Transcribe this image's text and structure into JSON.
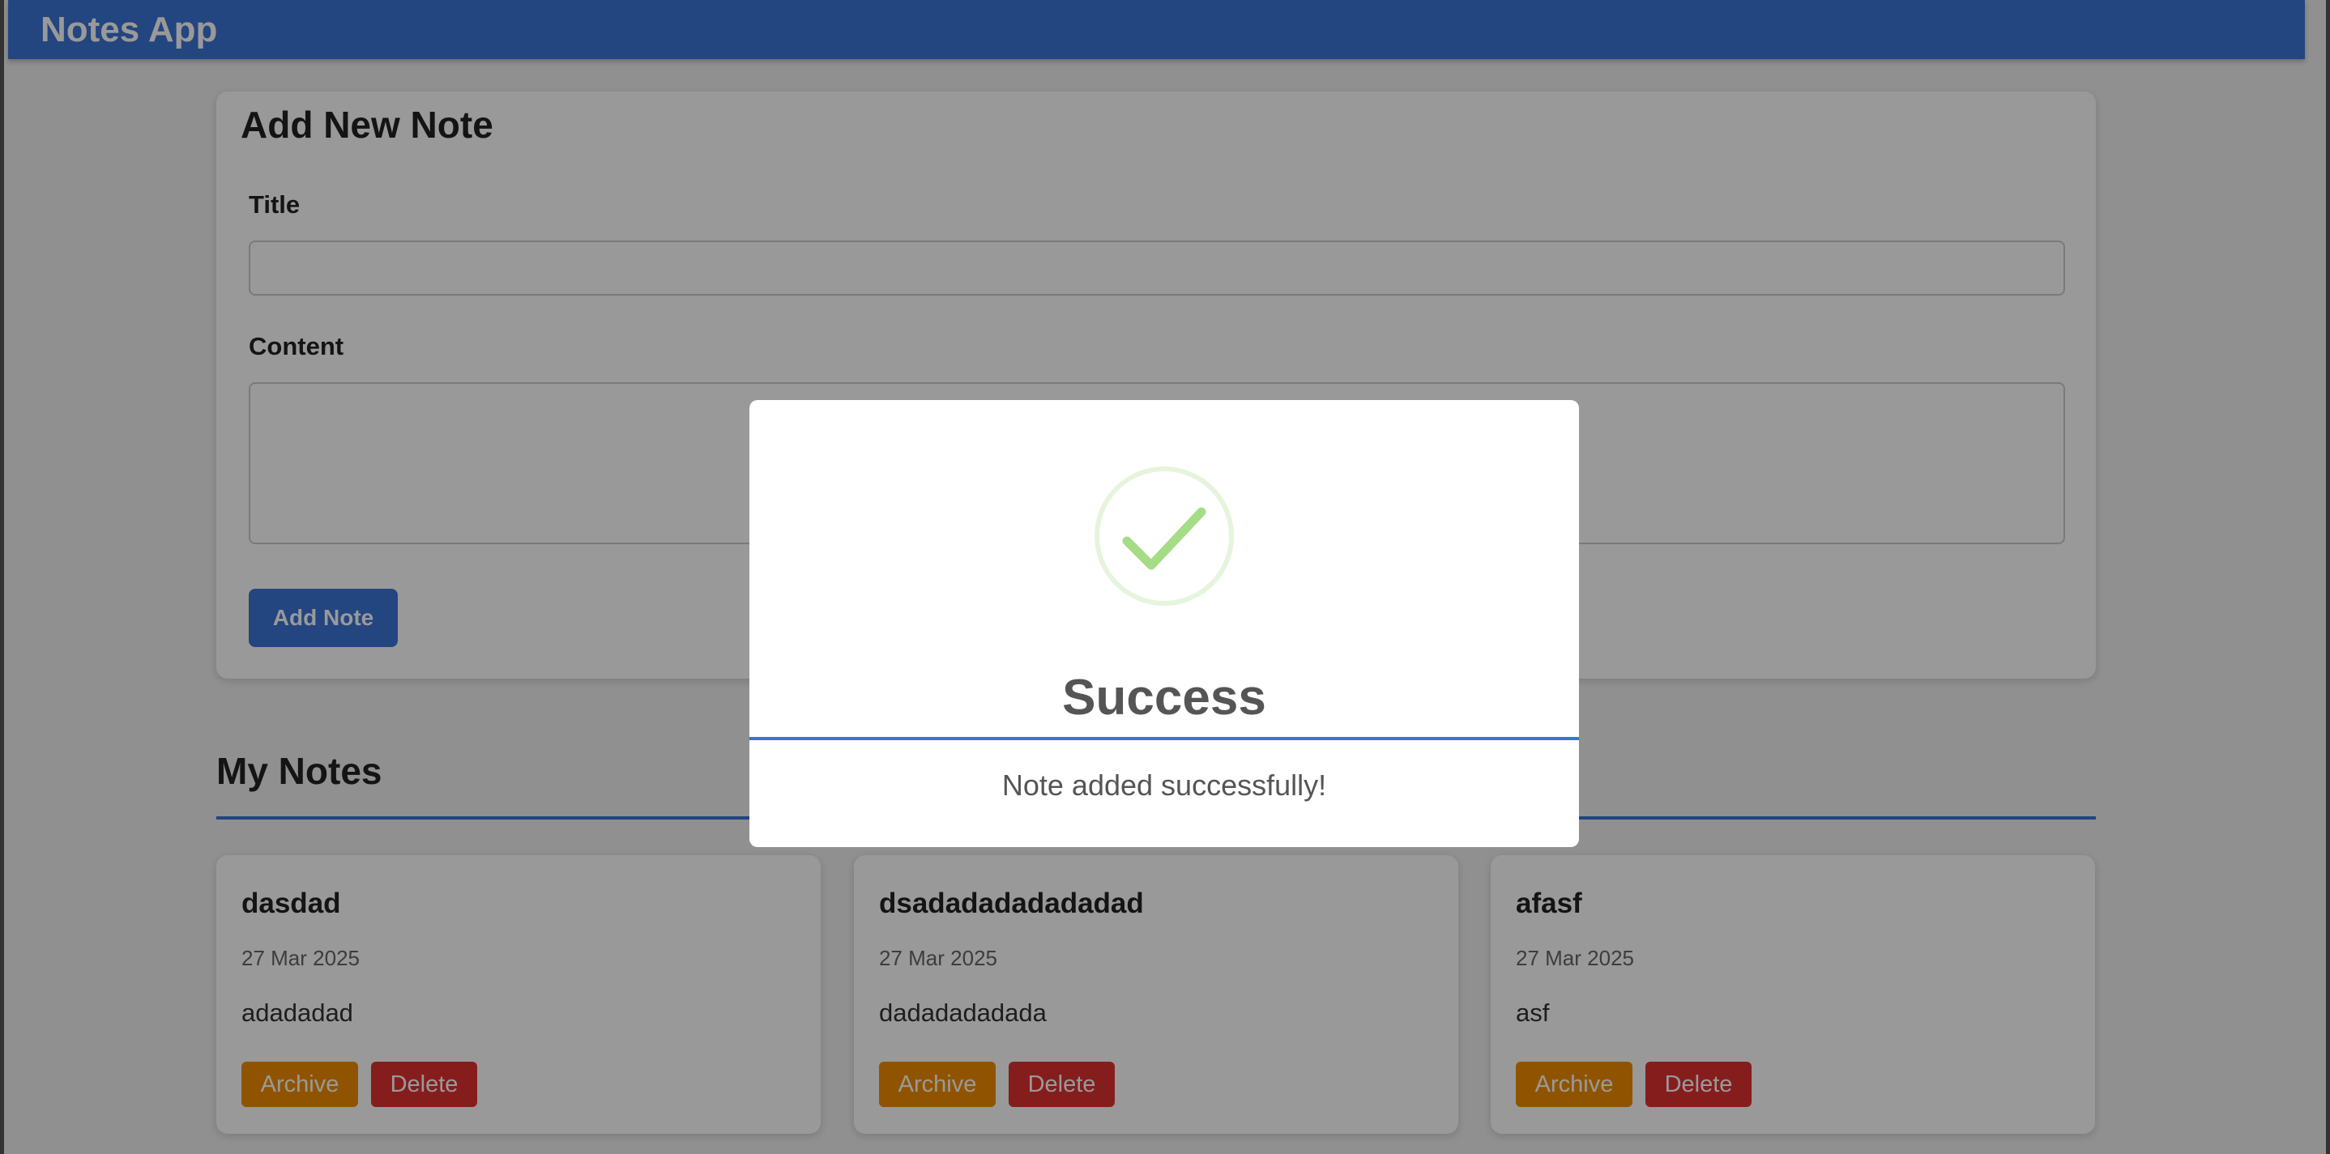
{
  "navbar": {
    "title": "Notes App"
  },
  "add_note": {
    "heading": "Add New Note",
    "title_label": "Title",
    "title_value": "",
    "content_label": "Content",
    "content_value": "",
    "submit_label": "Add Note"
  },
  "notes_section": {
    "heading": "My Notes",
    "notes": [
      {
        "title": "dasdad",
        "date": "27 Mar 2025",
        "body": "adadadad",
        "archive_label": "Archive",
        "delete_label": "Delete"
      },
      {
        "title": "dsadadadadadadad",
        "date": "27 Mar 2025",
        "body": "dadadadadada",
        "archive_label": "Archive",
        "delete_label": "Delete"
      },
      {
        "title": "afasf",
        "date": "27 Mar 2025",
        "body": "asf",
        "archive_label": "Archive",
        "delete_label": "Delete"
      }
    ]
  },
  "modal": {
    "icon": "success-check-icon",
    "title": "Success",
    "message": "Note added successfully!"
  },
  "colors": {
    "primary": "#3b73d6",
    "archive": "#f08c00",
    "delete": "#e03131",
    "success": "#a5dc86"
  }
}
